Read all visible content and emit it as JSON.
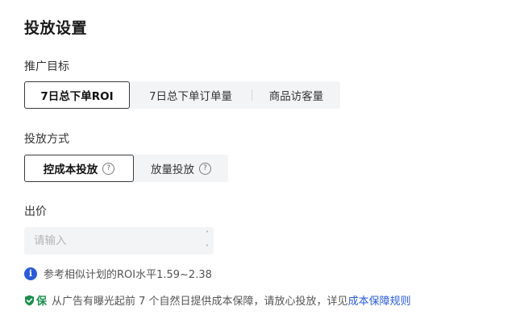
{
  "section_title": "投放设置",
  "target": {
    "label": "推广目标",
    "options": [
      "7日总下单ROI",
      "7日总下单订单量",
      "商品访客量"
    ]
  },
  "method": {
    "label": "投放方式",
    "options": [
      "控成本投放",
      "放量投放"
    ]
  },
  "bid": {
    "label": "出价",
    "placeholder": "请输入",
    "up_glyph": "˄",
    "down_glyph": "˅"
  },
  "hint": {
    "text": "参考相似计划的ROI水平1.59~2.38"
  },
  "guarantee": {
    "badge": "保",
    "text": "从广告有曝光起前 7 个自然日提供成本保障，请放心投放，详见",
    "link": "成本保障规则"
  },
  "colors": {
    "accent": "#2a5bd7",
    "guarantee_green": "#1c8f4e"
  }
}
